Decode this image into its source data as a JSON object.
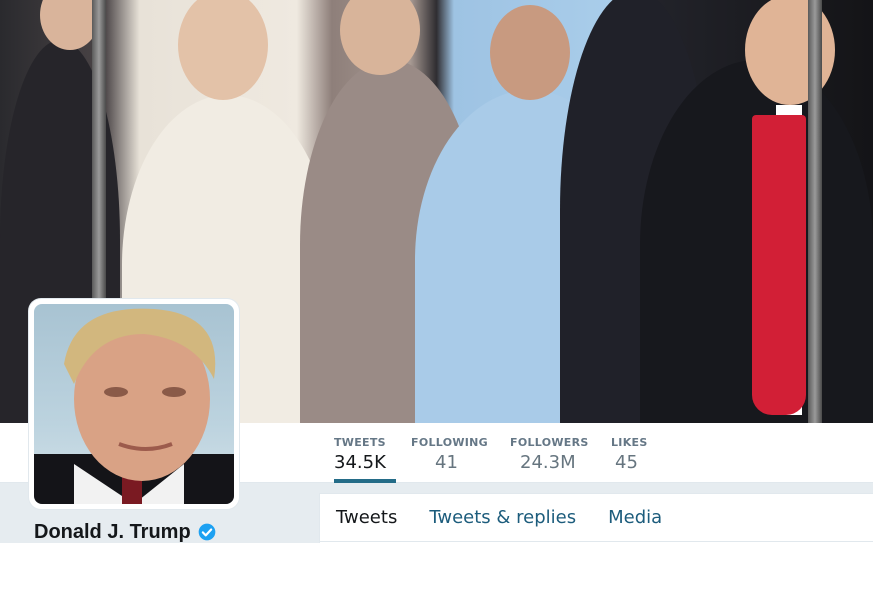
{
  "profile": {
    "name": "Donald J. Trump",
    "verified": true
  },
  "stats": [
    {
      "label": "TWEETS",
      "value": "34.5K"
    },
    {
      "label": "FOLLOWING",
      "value": "41"
    },
    {
      "label": "FOLLOWERS",
      "value": "24.3M"
    },
    {
      "label": "LIKES",
      "value": "45"
    }
  ],
  "tabs": [
    {
      "label": "Tweets"
    },
    {
      "label": "Tweets & replies"
    },
    {
      "label": "Media"
    }
  ],
  "colors": {
    "active_underline": "#246c88",
    "verified_badge": "#1da1f2",
    "tab_link": "#1c5c7c",
    "page_bg": "#e6ecf0"
  },
  "icons": {
    "verified": "verified-badge-icon"
  }
}
